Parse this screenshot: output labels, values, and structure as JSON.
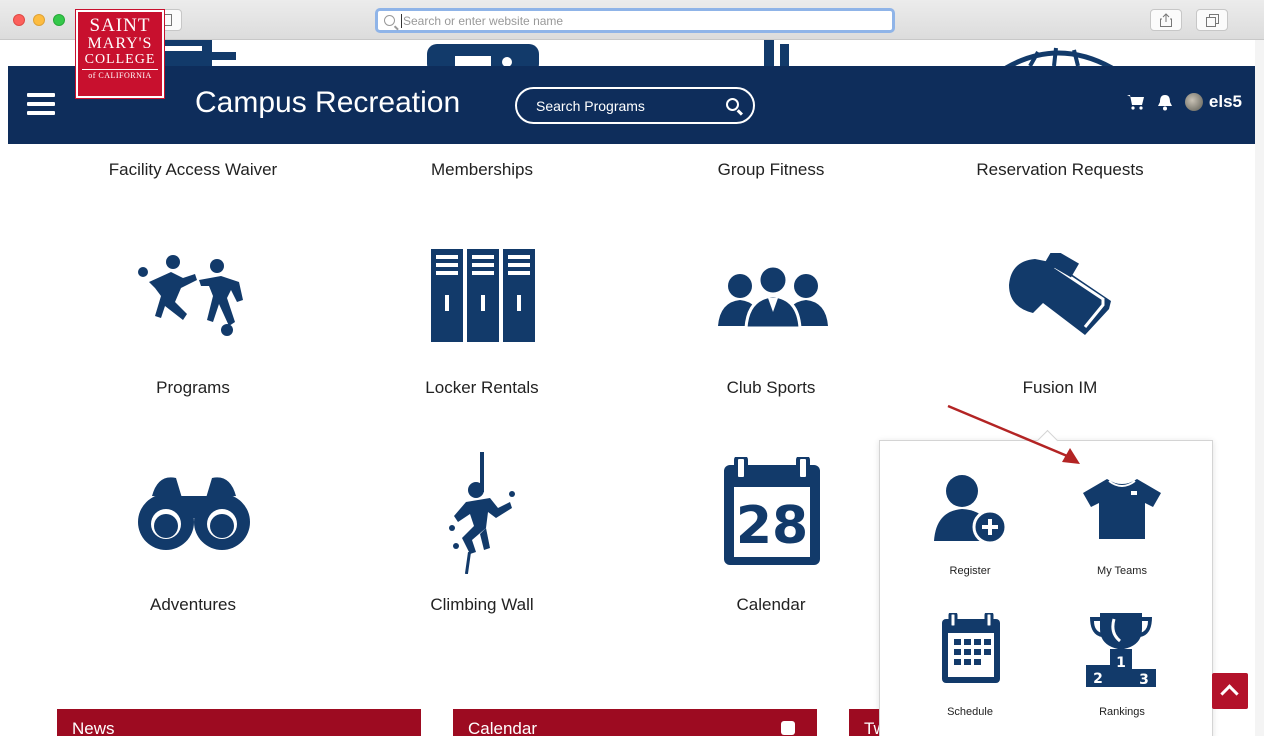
{
  "browser": {
    "address_placeholder": "Search or enter website name"
  },
  "header": {
    "logo": {
      "line1": "SAINT",
      "line2": "MARY'S",
      "line3": "COLLEGE",
      "line4": "of CALIFORNIA"
    },
    "title": "Campus Recreation",
    "search_placeholder": "Search Programs",
    "username": "els5"
  },
  "tiles_row1_labels": [
    "Facility Access Waiver",
    "Memberships",
    "Group Fitness",
    "Reservation Requests"
  ],
  "tiles_row2": [
    {
      "label": "Programs",
      "icon": "sports-players-icon"
    },
    {
      "label": "Locker Rentals",
      "icon": "lockers-icon"
    },
    {
      "label": "Club Sports",
      "icon": "group-people-icon"
    },
    {
      "label": "Fusion IM",
      "icon": "whistle-icon"
    }
  ],
  "tiles_row3": [
    {
      "label": "Adventures",
      "icon": "binoculars-icon"
    },
    {
      "label": "Climbing Wall",
      "icon": "climber-icon"
    },
    {
      "label": "Calendar",
      "icon": "calendar-icon",
      "day": "28"
    }
  ],
  "popup": {
    "items": [
      {
        "label": "Register",
        "icon": "register-user-icon"
      },
      {
        "label": "My Teams",
        "icon": "jersey-icon"
      },
      {
        "label": "Schedule",
        "icon": "schedule-calendar-icon"
      },
      {
        "label": "Rankings",
        "icon": "trophy-icon",
        "podium": [
          "2",
          "1",
          "3"
        ]
      }
    ]
  },
  "panels": [
    {
      "title": "News"
    },
    {
      "title": "Calendar"
    },
    {
      "title": "Tw"
    }
  ],
  "colors": {
    "navy": "#0e2d5b",
    "icon": "#123a6a",
    "red": "#9d0b21",
    "arrow": "#b32424"
  }
}
